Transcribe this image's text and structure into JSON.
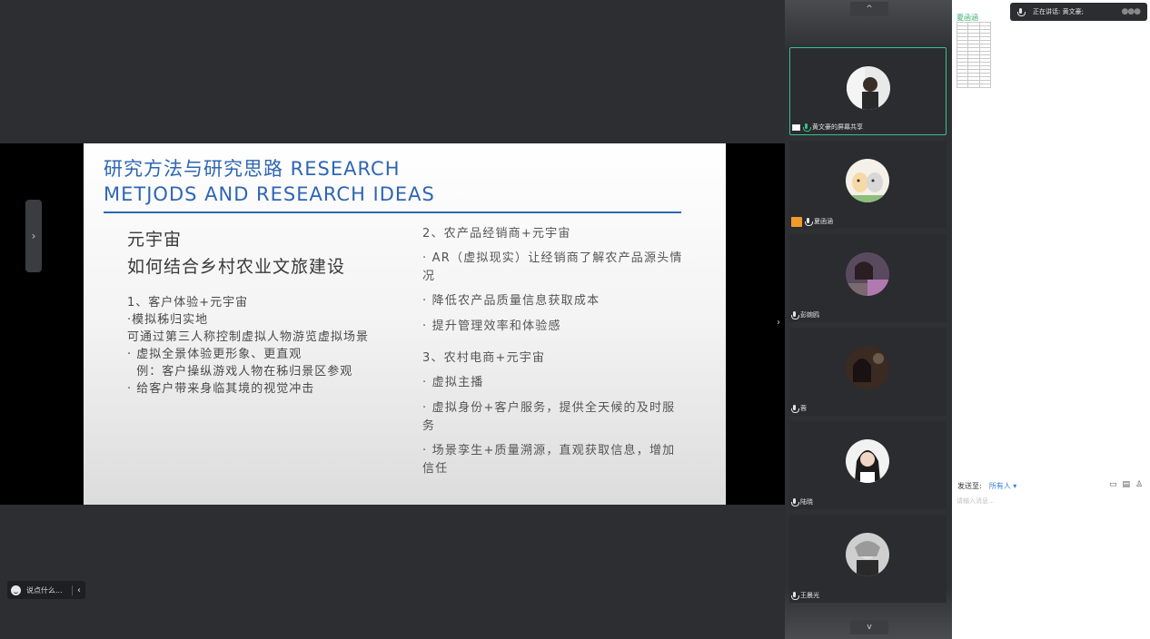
{
  "slide": {
    "title_line1": "研究方法与研究思路 RESEARCH",
    "title_line2": "METJODS AND RESEARCH IDEAS",
    "left": {
      "heading1": "元宇宙",
      "heading2": "如何结合乡村农业文旅建设",
      "lines": [
        "1、客户体验+元宇宙",
        "·模拟秭归实地",
        "可通过第三人称控制虚拟人物游览虚拟场景",
        "· 虚拟全景体验更形象、更直观",
        "  例：客户操纵游戏人物在秭归景区参观",
        "· 给客户带来身临其境的视觉冲击"
      ]
    },
    "right": {
      "lines": [
        "2、农产品经销商+元宇宙",
        "· AR（虚拟现实）让经销商了解农产品源头情",
        "况",
        "· 降低农产品质量信息获取成本",
        "· 提升管理效率和体验感",
        "3、农村电商+元宇宙",
        "· 虚拟主播",
        "· 虚拟身份+客户服务，提供全天候的及时服",
        "务",
        "· 场景孪生+质量溯源，直观获取信息，增加",
        "信任"
      ]
    }
  },
  "chat_pill": {
    "label": "说点什么..."
  },
  "video_column": {
    "scroll_up": "^",
    "scroll_down": "v",
    "tiles": [
      {
        "name": "黄文豪的屏幕共享",
        "active": true
      },
      {
        "name": "夏函涵",
        "active": false
      },
      {
        "name": "彭婉鸥",
        "active": false
      },
      {
        "name": "蓉",
        "active": false
      },
      {
        "name": "陆晓",
        "active": false
      },
      {
        "name": "王晨光",
        "active": false
      }
    ]
  },
  "chat_panel": {
    "speaking_label": "正在讲话: 黄文豪;",
    "roster_title": "夏函涵",
    "send_to_label": "发送至:",
    "send_to_target": "所有人 ▾",
    "input_placeholder": "请输入消息..."
  },
  "colors": {
    "accent_green": "#39c08a",
    "slide_title_blue": "#2f66b3",
    "link_blue": "#2f7de1"
  }
}
